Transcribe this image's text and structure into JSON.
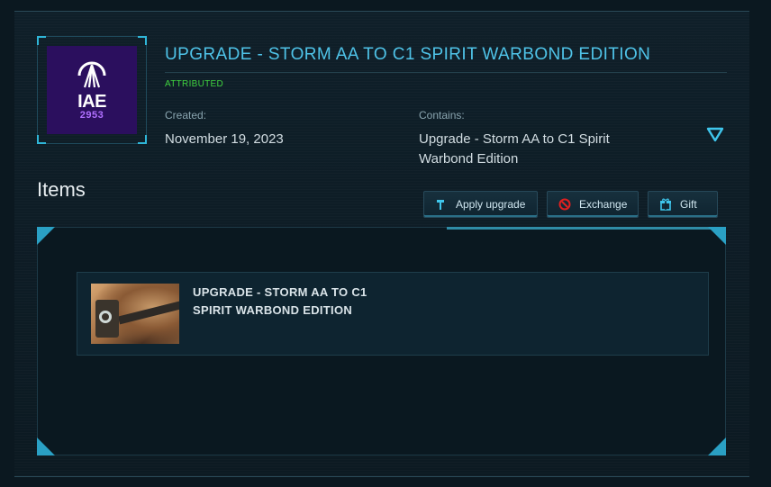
{
  "logo": {
    "brand": "IAE",
    "year": "2953"
  },
  "header": {
    "title": "UPGRADE - STORM AA TO C1 SPIRIT WARBOND EDITION",
    "status": "ATTRIBUTED",
    "created_label": "Created:",
    "created_value": "November 19, 2023",
    "contains_label": "Contains:",
    "contains_value": "Upgrade - Storm AA to C1 Spirit Warbond Edition"
  },
  "items": {
    "heading": "Items",
    "buttons": {
      "apply": "Apply upgrade",
      "exchange": "Exchange",
      "gift": "Gift"
    },
    "list": [
      {
        "title": "UPGRADE - STORM AA TO C1 SPIRIT WARBOND EDITION"
      }
    ]
  },
  "colors": {
    "accent": "#4fc3e8",
    "status": "#3fd13f",
    "logo_bg": "#2b0f5e",
    "exchange_icon": "#e02020"
  },
  "icons": {
    "toggle": "chevron-down-icon",
    "apply": "hammer-icon",
    "exchange": "exchange-icon",
    "gift": "gift-icon"
  }
}
